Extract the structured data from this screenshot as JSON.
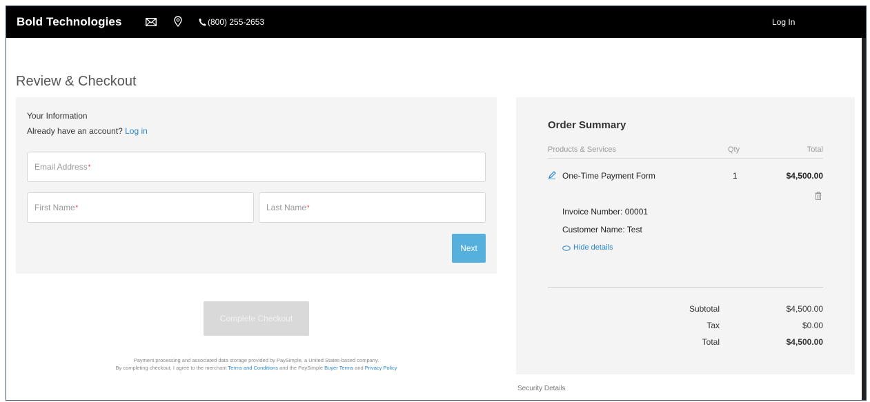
{
  "header": {
    "brand": "Bold Technologies",
    "phone": "(800) 255-2653",
    "login_label": "Log In"
  },
  "page_title": "Review & Checkout",
  "info": {
    "heading": "Your Information",
    "account_prompt": "Already have an account?",
    "login_link": "Log in",
    "email_placeholder": "Email Address",
    "first_name_placeholder": "First Name",
    "last_name_placeholder": "Last Name",
    "required_marker": "*",
    "next_label": "Next"
  },
  "checkout": {
    "complete_label": "Complete Checkout",
    "legal_line1": "Payment processing and associated data storage provided by PaySimple, a United States-based company.",
    "legal_line2_prefix": "By completing checkout, I agree to the merchant",
    "terms_link": "Terms and Conditions",
    "legal_line2_mid": "and the PaySimple",
    "buyer_terms_link": "Buyer Terms",
    "legal_and": "and",
    "privacy_link": "Privacy Policy"
  },
  "summary": {
    "title": "Order Summary",
    "columns": {
      "products": "Products & Services",
      "qty": "Qty",
      "total": "Total"
    },
    "item": {
      "name": "One-Time Payment Form",
      "qty": "1",
      "total": "$4,500.00",
      "invoice": "Invoice Number: 00001",
      "customer": "Customer Name: Test",
      "hide_details": "Hide details"
    },
    "subtotal_label": "Subtotal",
    "subtotal_value": "$4,500.00",
    "tax_label": "Tax",
    "tax_value": "$0.00",
    "total_label": "Total",
    "total_value": "$4,500.00"
  },
  "security_label": "Security Details",
  "colors": {
    "accent": "#2a86c9",
    "next_button": "#55b0de",
    "topbar": "#000000"
  }
}
